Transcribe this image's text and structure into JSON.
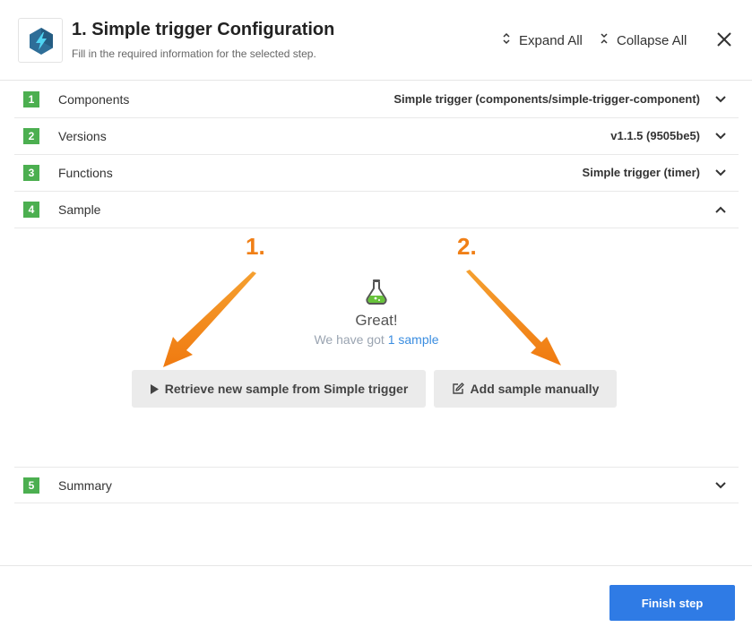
{
  "header": {
    "title": "1. Simple trigger Configuration",
    "subtitle": "Fill in the required information for the selected step.",
    "expand_all": "Expand All",
    "collapse_all": "Collapse All",
    "logo_icon": "lightning-bolt-icon"
  },
  "steps": [
    {
      "number": "1",
      "label": "Components",
      "value": "Simple trigger (components/simple-trigger-component)",
      "expanded": false
    },
    {
      "number": "2",
      "label": "Versions",
      "value": "v1.1.5 (9505be5)",
      "expanded": false
    },
    {
      "number": "3",
      "label": "Functions",
      "value": "Simple trigger (timer)",
      "expanded": false
    },
    {
      "number": "4",
      "label": "Sample",
      "value": "",
      "expanded": true
    },
    {
      "number": "5",
      "label": "Summary",
      "value": "",
      "expanded": false
    }
  ],
  "sample": {
    "annotation_1": "1.",
    "annotation_2": "2.",
    "status_title": "Great!",
    "status_prefix": "We have got ",
    "status_link": "1 sample",
    "retrieve_button": "Retrieve new sample from Simple trigger",
    "manual_button": "Add sample manually",
    "flask_icon": "flask-icon"
  },
  "footer": {
    "finish_button": "Finish step"
  },
  "colors": {
    "step_badge": "#4caf50",
    "primary": "#2f7be5",
    "annotation": "#f07f16",
    "link": "#3a8de0"
  }
}
